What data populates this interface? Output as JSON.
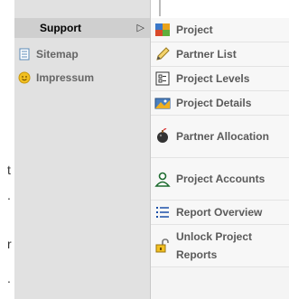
{
  "left_menu": {
    "items": [
      {
        "label": "Support",
        "icon": "support-icon"
      },
      {
        "label": "Sitemap",
        "icon": "sitemap-icon"
      },
      {
        "label": "Impressum",
        "icon": "smiley-icon"
      }
    ],
    "submenu_arrow": "▷"
  },
  "page_fragments": [
    "t",
    ".",
    "r",
    "."
  ],
  "submenu": {
    "items": [
      {
        "label": "Project",
        "icon": "project-icon"
      },
      {
        "label": "Partner List",
        "icon": "pencil-icon"
      },
      {
        "label": "Project Levels",
        "icon": "levels-icon"
      },
      {
        "label": "Project Details",
        "icon": "details-icon"
      },
      {
        "label": "Partner Allocation",
        "icon": "bomb-icon"
      },
      {
        "label": "Project Accounts",
        "icon": "user-icon"
      },
      {
        "label": "Report Overview",
        "icon": "list-icon"
      },
      {
        "label": "Unlock Project Reports",
        "icon": "unlock-icon"
      }
    ]
  },
  "colors": {
    "menu_bg": "#e1e1e1",
    "submenu_bg": "#f7f7f7",
    "text": "#5a5a5a"
  }
}
